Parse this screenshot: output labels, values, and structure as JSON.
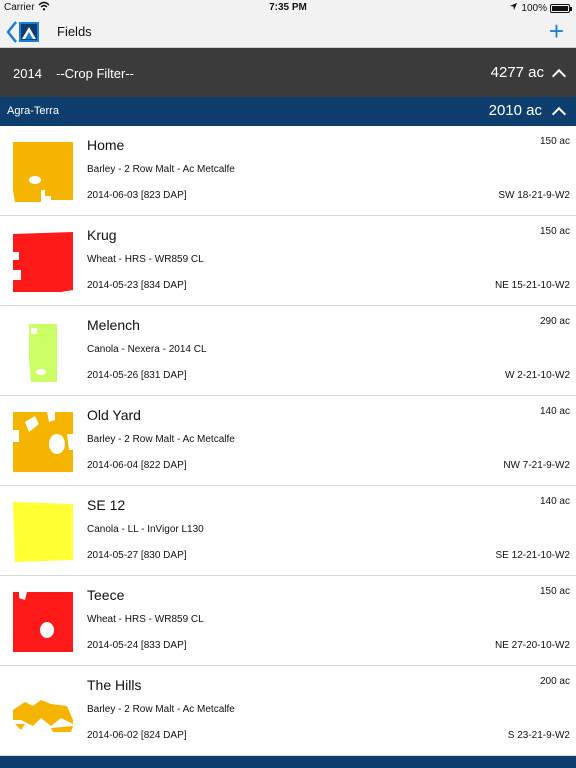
{
  "status": {
    "carrier": "Carrier",
    "time": "7:35 PM",
    "battery": "100%",
    "battery_level": 1.0
  },
  "nav": {
    "title": "Fields",
    "add_label": "+"
  },
  "filter": {
    "year": "2014",
    "crop": "--Crop Filter--",
    "total": "4277 ac"
  },
  "group": {
    "name": "Agra-Terra",
    "total": "2010 ac"
  },
  "fields": [
    {
      "name": "Home",
      "crop": "Barley - 2 Row Malt - Ac Metcalfe",
      "date": "2014-06-03 [823 DAP]",
      "acres": "150 ac",
      "location": "SW 18-21-9-W2",
      "color": "#f4b400"
    },
    {
      "name": "Krug",
      "crop": "Wheat - HRS - WR859 CL",
      "date": "2014-05-23 [834 DAP]",
      "acres": "150 ac",
      "location": "NE 15-21-10-W2",
      "color": "#ff1a1a"
    },
    {
      "name": "Melench",
      "crop": "Canola - Nexera - 2014 CL",
      "date": "2014-05-26 [831 DAP]",
      "acres": "290 ac",
      "location": "W 2-21-10-W2",
      "color": "#ccff66"
    },
    {
      "name": "Old Yard",
      "crop": "Barley - 2 Row Malt - Ac Metcalfe",
      "date": "2014-06-04 [822 DAP]",
      "acres": "140 ac",
      "location": "NW 7-21-9-W2",
      "color": "#f4b400"
    },
    {
      "name": "SE 12",
      "crop": "Canola - LL - InVigor L130",
      "date": "2014-05-27 [830 DAP]",
      "acres": "140 ac",
      "location": "SE 12-21-10-W2",
      "color": "#ffff33"
    },
    {
      "name": "Teece",
      "crop": "Wheat - HRS - WR859 CL",
      "date": "2014-05-24 [833 DAP]",
      "acres": "150 ac",
      "location": "NE 27-20-10-W2",
      "color": "#ff1a1a"
    },
    {
      "name": "The Hills",
      "crop": "Barley - 2 Row Malt - Ac Metcalfe",
      "date": "2014-06-02 [824 DAP]",
      "acres": "200 ac",
      "location": "S 23-21-9-W2",
      "color": "#f4b400"
    }
  ]
}
